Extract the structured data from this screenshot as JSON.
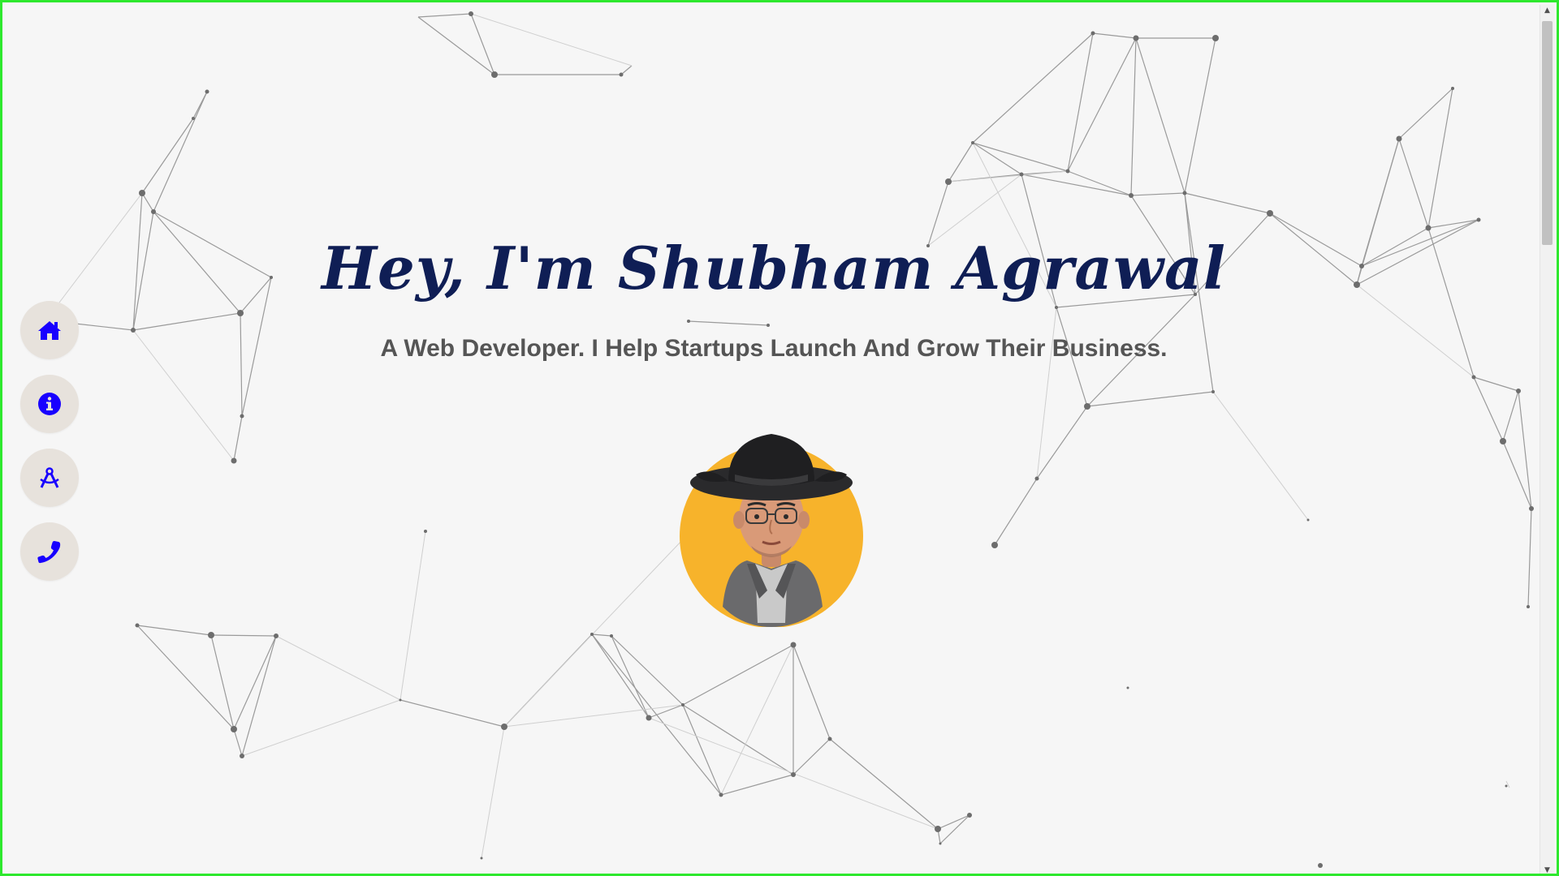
{
  "hero": {
    "title": "Hey, I'm Shubham Agrawal",
    "subtitle": "A Web Developer. I Help Startups Launch And Grow Their Business."
  },
  "side_nav": {
    "items": [
      {
        "icon": "home-icon",
        "label": "Home"
      },
      {
        "icon": "info-icon",
        "label": "About"
      },
      {
        "icon": "compass-drafting-icon",
        "label": "Projects"
      },
      {
        "icon": "phone-icon",
        "label": "Contact"
      }
    ]
  },
  "colors": {
    "title": "#0f1e55",
    "subtitle": "#555555",
    "nav_icon": "#1800ff",
    "nav_bg": "#e7e2dc",
    "avatar_bg": "#f7b32b",
    "frame": "#2ee82e",
    "background": "#f6f6f6"
  },
  "avatar": {
    "icon": "memoji-avatar-cowboy-hat"
  },
  "scrollbar": {
    "up_glyph": "▲",
    "down_glyph": "▼"
  }
}
